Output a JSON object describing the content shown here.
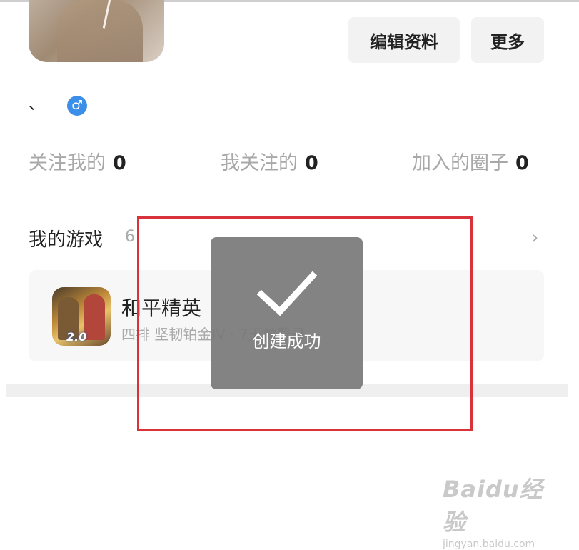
{
  "profile": {
    "name_mark": "、",
    "gender_symbol": "♂"
  },
  "actions": {
    "edit_label": "编辑资料",
    "more_label": "更多"
  },
  "stats": [
    {
      "label": "关注我的",
      "value": "0"
    },
    {
      "label": "我关注的",
      "value": "0"
    },
    {
      "label": "加入的圈子",
      "value": "0"
    }
  ],
  "games": {
    "title": "我的游戏",
    "count": "6",
    "chevron": "›",
    "items": [
      {
        "name": "和平精英",
        "subtitle": "四排 坚韧铂金IV · 7天前登录",
        "icon_badge": "2.0"
      }
    ]
  },
  "toast": {
    "icon": "checkmark-icon",
    "message": "创建成功"
  },
  "watermark": {
    "logo": "Baidu经验",
    "url": "jingyan.baidu.com"
  },
  "colors": {
    "highlight_border": "#d8333a",
    "gender_badge": "#3b8fe8",
    "toast_bg": "#787878"
  }
}
